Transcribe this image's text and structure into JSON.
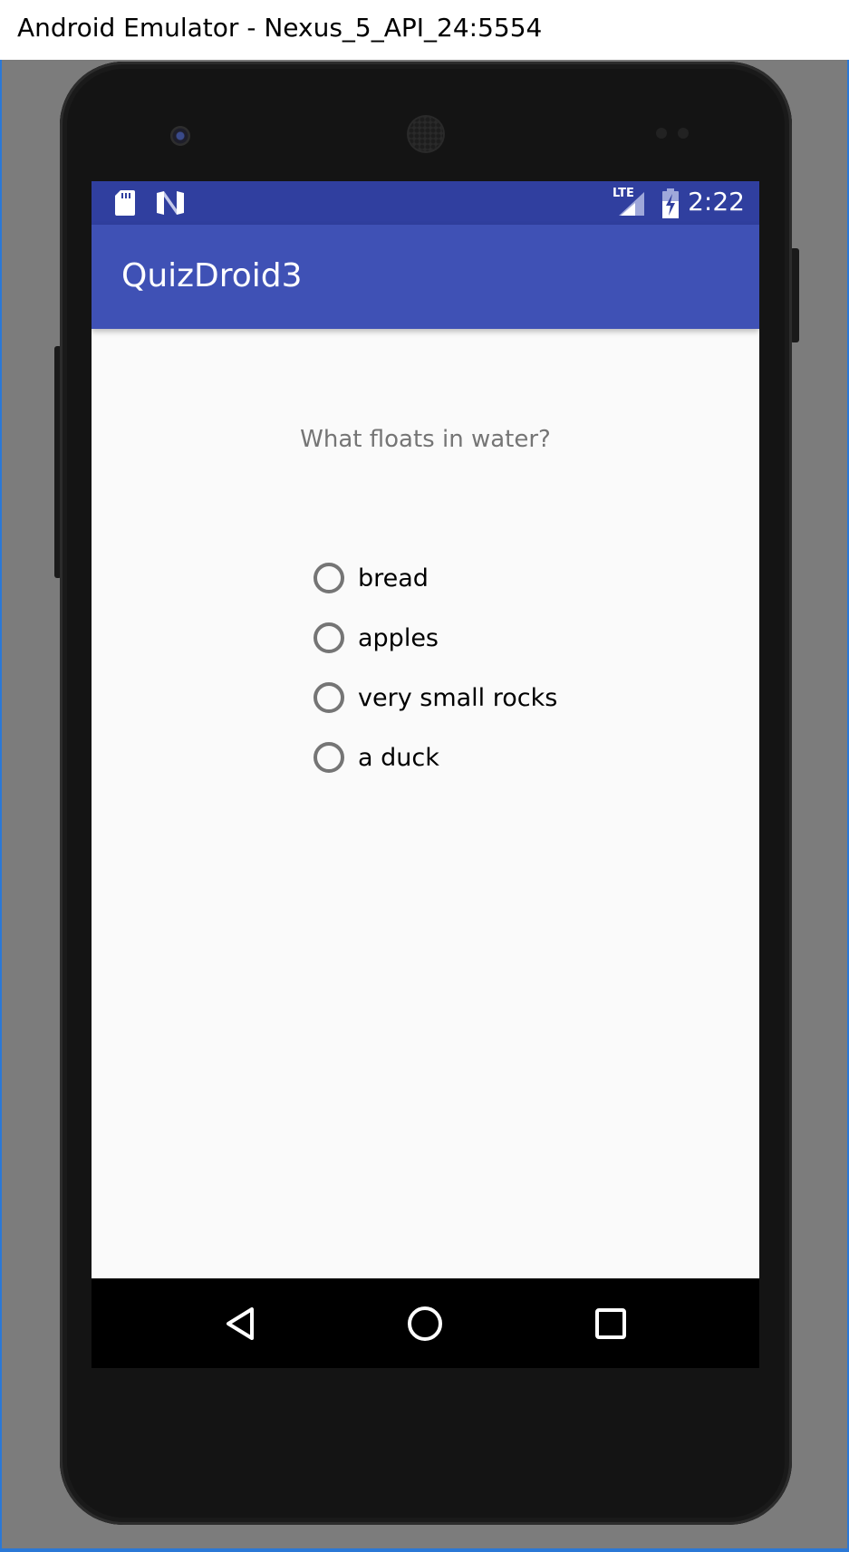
{
  "window": {
    "title": "Android Emulator - Nexus_5_API_24:5554"
  },
  "statusbar": {
    "time": "2:22",
    "network_label": "LTE",
    "icons": [
      "sd-card-icon",
      "n-logo-icon",
      "lte-signal-icon",
      "battery-charging-icon"
    ]
  },
  "app": {
    "title": "QuizDroid3"
  },
  "quiz": {
    "question": "What floats in water?",
    "options": [
      {
        "label": "bread",
        "selected": false
      },
      {
        "label": "apples",
        "selected": false
      },
      {
        "label": "very small rocks",
        "selected": false
      },
      {
        "label": "a duck",
        "selected": false
      }
    ]
  },
  "navbar": {
    "buttons": [
      "back-icon",
      "home-icon",
      "recents-icon"
    ]
  },
  "colors": {
    "statusbar": "#303f9f",
    "appbar": "#3f51b5",
    "background": "#fafafa",
    "question_text": "#757575",
    "radio_outline": "#757575",
    "emulator_backdrop": "#7c7c7c"
  }
}
